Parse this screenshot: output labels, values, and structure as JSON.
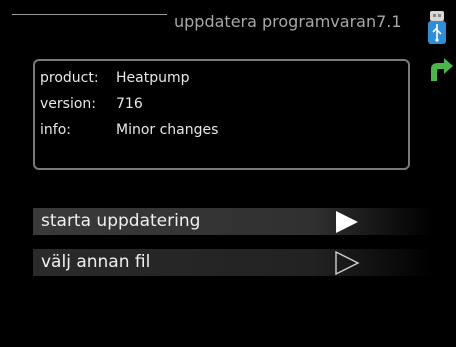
{
  "header": {
    "title": "uppdatera programvaran7.1"
  },
  "icons": {
    "usb": "usb-icon",
    "back": "back-arrow-icon",
    "play_filled": "play-filled-icon",
    "play_outline": "play-outline-icon"
  },
  "info": {
    "rows": [
      {
        "label": "product:",
        "value": "Heatpump"
      },
      {
        "label": "version:",
        "value": "716"
      },
      {
        "label": "info:",
        "value": "Minor changes"
      }
    ]
  },
  "menu": {
    "items": [
      {
        "label": "starta uppdatering"
      },
      {
        "label": "välj annan fil"
      }
    ]
  },
  "colors": {
    "background": "#000000",
    "usb_blue": "#2f8fd6",
    "back_green": "#4db34d"
  }
}
